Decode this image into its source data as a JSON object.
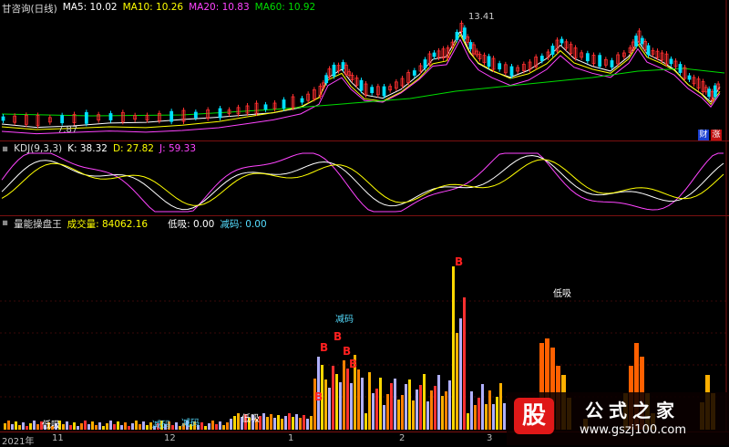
{
  "price_header": {
    "title": "甘咨询(日线)",
    "ma5": "MA5: 10.02",
    "ma10": "MA10: 10.26",
    "ma20": "MA20: 10.83",
    "ma60": "MA60: 10.92",
    "colors": {
      "ma5": "#ffffff",
      "ma10": "#ffff00",
      "ma20": "#ff44ff",
      "ma60": "#00dd00"
    }
  },
  "price_labels": {
    "high": "13.41",
    "low": "7.87"
  },
  "badges": {
    "cai": "财",
    "zhang": "涨"
  },
  "kdj_header": {
    "name": "KDJ(9,3,3)",
    "k": "K: 38.32",
    "d": "D: 27.82",
    "j": "J: 59.33"
  },
  "vol_header": {
    "name": "量能操盘王",
    "volume": "成交量: 84062.16",
    "dixi": "低吸: 0.00",
    "jianma": "减码: 0.00"
  },
  "signals": {
    "b": "B",
    "dixi": "低吸",
    "jianma": "减码"
  },
  "xaxis": {
    "labels": [
      "2021年",
      "11",
      "12",
      "1",
      "2",
      "3"
    ]
  },
  "watermark": {
    "icon_char": "股",
    "title": "公式之家",
    "url": "www.gszj100.com"
  }
}
